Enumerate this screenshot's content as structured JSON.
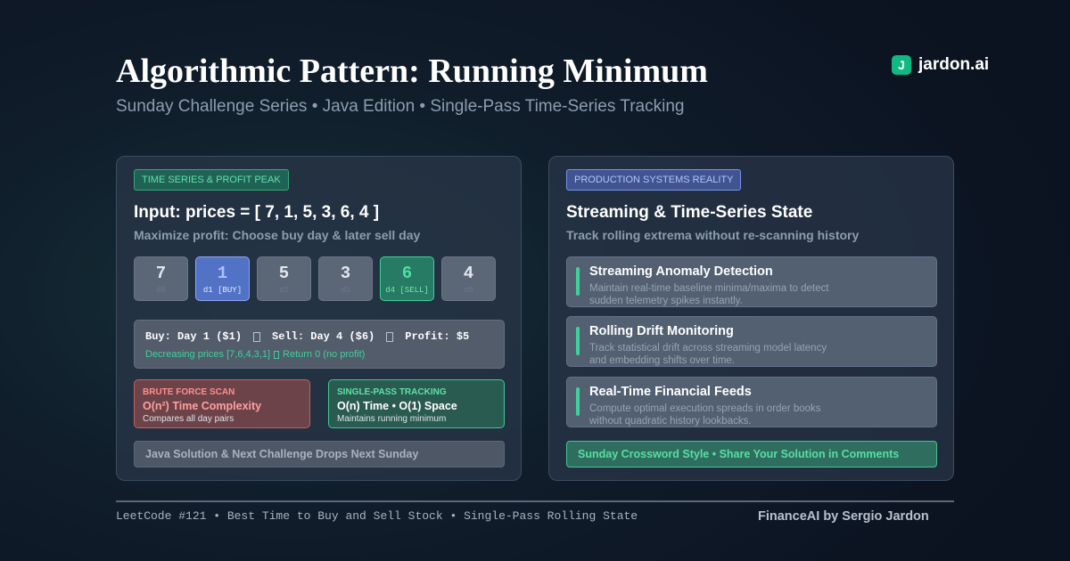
{
  "header": {
    "title": "Algorithmic Pattern: Running Minimum",
    "subtitle": "Sunday Challenge Series • Java Edition • Single-Pass Time-Series Tracking"
  },
  "brand": {
    "logo_letter": "J",
    "name": "jardon.ai",
    "logo_color": "#10b981"
  },
  "left_panel": {
    "tag": "TIME SERIES & PROFIT PEAK",
    "heading": "Input: prices = [ 7, 1, 5, 3, 6, 4 ]",
    "subheading": "Maximize profit: Choose buy day & later sell day",
    "days": [
      {
        "value": "7",
        "label": "d0",
        "state": "normal"
      },
      {
        "value": "1",
        "label": "d1 [BUY]",
        "state": "buy"
      },
      {
        "value": "5",
        "label": "d2",
        "state": "normal"
      },
      {
        "value": "3",
        "label": "d3",
        "state": "normal"
      },
      {
        "value": "6",
        "label": "d4 [SELL]",
        "state": "sell"
      },
      {
        "value": "4",
        "label": "d5",
        "state": "normal"
      }
    ],
    "summary": {
      "buy": "Buy: Day 1 ($1)",
      "sell": "Sell: Day 4 ($6)",
      "profit": "Profit: $5",
      "note_before": "Decreasing prices [7,6,4,3,1]",
      "note_after": "Return 0 (no profit)"
    },
    "brute": {
      "tag": "BRUTE FORCE SCAN",
      "title": "O(n²) Time Complexity",
      "desc": "Compares all day pairs"
    },
    "single": {
      "tag": "SINGLE-PASS TRACKING",
      "title": "O(n) Time • O(1) Space",
      "desc": "Maintains running minimum"
    },
    "bottom": "Java Solution & Next Challenge Drops Next Sunday"
  },
  "right_panel": {
    "tag": "PRODUCTION SYSTEMS REALITY",
    "heading": "Streaming & Time-Series State",
    "subheading": "Track rolling extrema without re-scanning history",
    "items": [
      {
        "title": "Streaming Anomaly Detection",
        "desc": "Maintain real-time baseline minima/maxima to detect sudden telemetry spikes instantly."
      },
      {
        "title": "Rolling Drift Monitoring",
        "desc": "Track statistical drift across streaming model latency and embedding shifts over time."
      },
      {
        "title": "Real-Time Financial Feeds",
        "desc": "Compute optimal execution spreads in order books without quadratic history lookbacks."
      }
    ],
    "footer": "Sunday Crossword Style • Share Your Solution in Comments"
  },
  "footer": {
    "left": "LeetCode #121 • Best Time to Buy and Sell Stock • Single-Pass Rolling State",
    "right": "FinanceAI by Sergio Jardon"
  }
}
